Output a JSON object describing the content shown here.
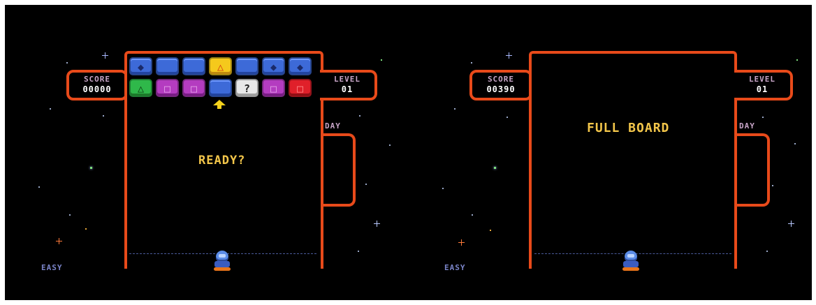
{
  "screens": [
    {
      "score_label": "SCORE",
      "score_value": "00000",
      "level_label": "LEVEL",
      "level_value": "01",
      "day_label": "DAY",
      "message": "READY?",
      "difficulty": "EASY"
    },
    {
      "score_label": "SCORE",
      "score_value": "00390",
      "level_label": "LEVEL",
      "level_value": "01",
      "day_label": "DAY",
      "message": "FULL BOARD",
      "difficulty": "EASY"
    }
  ],
  "board": {
    "row1": [
      {
        "color": "blue",
        "symbol": "◆"
      },
      {
        "color": "blue",
        "symbol": ""
      },
      {
        "color": "blue",
        "symbol": ""
      },
      {
        "color": "yellow",
        "symbol": "△"
      },
      {
        "color": "blue",
        "symbol": ""
      },
      {
        "color": "blue",
        "symbol": "◆"
      },
      {
        "color": "blue",
        "symbol": "◆"
      }
    ],
    "row2": [
      {
        "color": "green",
        "symbol": "△"
      },
      {
        "color": "purple",
        "symbol": "□"
      },
      {
        "color": "purple",
        "symbol": "□"
      },
      {
        "color": "blue",
        "symbol": ""
      },
      {
        "color": "white",
        "symbol": "?"
      },
      {
        "color": "purple",
        "symbol": "□"
      },
      {
        "color": "red",
        "symbol": "□"
      }
    ]
  },
  "colors": {
    "frame": "#e84a1a",
    "text_yellow": "#f3c64a",
    "label": "#c6a4c6",
    "background": "#000000"
  }
}
